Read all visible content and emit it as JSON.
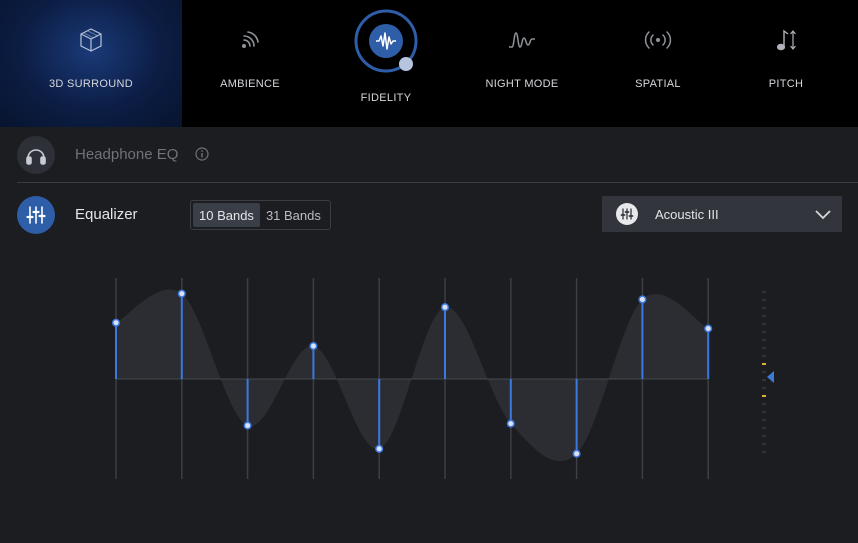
{
  "effects": [
    {
      "label": "3D SURROUND",
      "icon": "cube-icon",
      "active": true
    },
    {
      "label": "AMBIENCE",
      "icon": "ambience-icon",
      "active": false
    },
    {
      "label": "FIDELITY",
      "icon": "waveform-icon",
      "active": true,
      "dial_level": 0.78
    },
    {
      "label": "NIGHT MODE",
      "icon": "night-wave-icon",
      "active": false
    },
    {
      "label": "SPATIAL",
      "icon": "spatial-icon",
      "active": false
    },
    {
      "label": "PITCH",
      "icon": "pitch-note-icon",
      "active": false
    }
  ],
  "headphone_eq": {
    "label": "Headphone EQ",
    "icon": "headphones-icon",
    "info_icon": "info-icon"
  },
  "equalizer": {
    "label": "Equalizer",
    "icon": "equalizer-sliders-icon",
    "band_options": [
      "10 Bands",
      "31 Bands"
    ],
    "selected_band_option": "10 Bands",
    "preset": {
      "label": "Acoustic III",
      "icon": "preset-sliders-icon",
      "dropdown_icon": "chevron-down-icon"
    }
  },
  "chart_data": {
    "type": "line",
    "bands": 10,
    "gains": [
      0.58,
      0.88,
      -0.48,
      0.34,
      -0.72,
      0.74,
      -0.46,
      -0.77,
      0.82,
      0.52
    ],
    "ylim": [
      -1,
      1
    ],
    "master_level": 0.0
  },
  "colors": {
    "accent": "#3d7ad6",
    "accent_dark": "#2f5ea8",
    "topbar_bg": "#000000",
    "panel_bg": "#1c1d21",
    "band_line": "#3d78e0",
    "yellow_tick": "#d8b43a"
  }
}
